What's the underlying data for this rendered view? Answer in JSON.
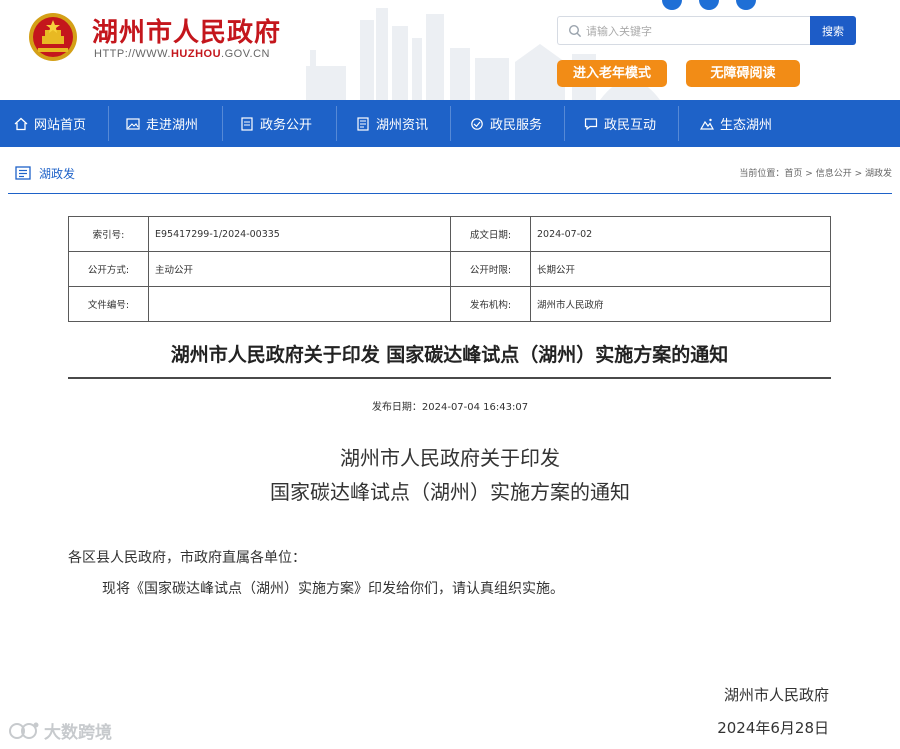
{
  "header": {
    "site_name": "湖州市人民政府",
    "site_url_prefix": "HTTP://WWW.",
    "site_url_highlight": "HUZHOU",
    "site_url_suffix": ".GOV.CN",
    "search_placeholder": "请输入关键字",
    "search_button": "搜索",
    "elder_mode_button": "进入老年模式",
    "accessible_reading_button": "无障碍阅读",
    "brand_red": "#c4161c",
    "accent_orange": "#f28c16"
  },
  "nav": {
    "bar_color": "#1e62c8",
    "items": [
      {
        "label": "网站首页",
        "icon": "home-icon"
      },
      {
        "label": "走进湖州",
        "icon": "picture-icon"
      },
      {
        "label": "政务公开",
        "icon": "document-icon"
      },
      {
        "label": "湖州资讯",
        "icon": "news-icon"
      },
      {
        "label": "政民服务",
        "icon": "service-icon"
      },
      {
        "label": "政民互动",
        "icon": "chat-icon"
      },
      {
        "label": "生态湖州",
        "icon": "mountain-icon"
      }
    ]
  },
  "section": {
    "title": "湖政发",
    "breadcrumb_prefix": "当前位置：",
    "breadcrumb": [
      "首页",
      "信息公开",
      "湖政发"
    ],
    "separator": " > "
  },
  "meta": {
    "index_label": "索引号:",
    "index_value": "E95417299-1/2024-00335",
    "date_label": "成文日期:",
    "date_value": "2024-07-02",
    "open_mode_label": "公开方式:",
    "open_mode_value": "主动公开",
    "open_period_label": "公开时限:",
    "open_period_value": "长期公开",
    "doc_no_label": "文件编号:",
    "doc_no_value": "",
    "issuer_label": "发布机构:",
    "issuer_value": "湖州市人民政府"
  },
  "article": {
    "title": "湖州市人民政府关于印发 国家碳达峰试点（湖州）实施方案的通知",
    "publish_date": "发布日期：2024-07-04 16:43:07",
    "heading_line1": "湖州市人民政府关于印发",
    "heading_line2": "国家碳达峰试点（湖州）实施方案的通知",
    "salutation": "各区县人民政府，市政府直属各单位：",
    "body": "现将《国家碳达峰试点（湖州）实施方案》印发给你们，请认真组织实施。",
    "signer": "湖州市人民政府",
    "sign_date": "2024年6月28日"
  },
  "watermark": {
    "text": "大数跨境"
  }
}
